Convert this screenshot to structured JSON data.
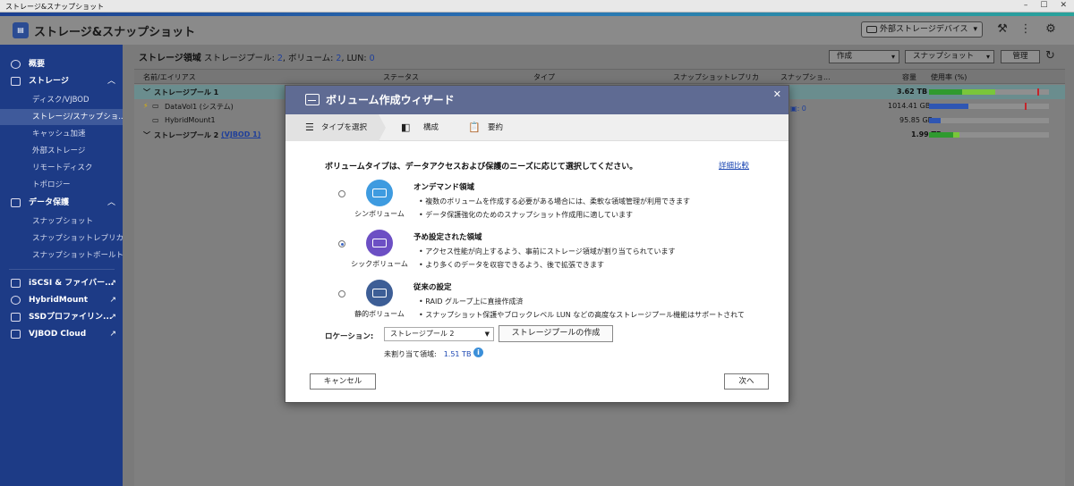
{
  "window": {
    "title": "ストレージ&スナップショット",
    "controls": [
      "–",
      "☐",
      "✕"
    ]
  },
  "app": {
    "title": "ストレージ&スナップショット",
    "external_device_label": "外部ストレージデバイス"
  },
  "sidebar": {
    "overview": "概要",
    "storage_section": "ストレージ",
    "storage_items": [
      "ディスク/VJBOD",
      "ストレージ/スナップショ...",
      "キャッシュ加速",
      "外部ストレージ",
      "リモートディスク",
      "トポロジー"
    ],
    "protection_section": "データ保護",
    "protection_items": [
      "スナップショット",
      "スナップショットレプリカ",
      "スナップショットボールト"
    ],
    "extras": [
      "iSCSI & ファイバー...",
      "HybridMount",
      "SSDプロファイリン...",
      "VJBOD Cloud"
    ]
  },
  "main": {
    "breadcrumb": {
      "title": "ストレージ領域",
      "pools_label": "ストレージプール: ",
      "pools": "2",
      "volumes_label": ", ボリューム: ",
      "volumes": "2",
      "lun_label": ", LUN: ",
      "lun": "0"
    },
    "toolbar": {
      "create": "作成",
      "snapshot": "スナップショット",
      "manage": "管理"
    },
    "columns": [
      "名前/エイリアス",
      "ステータス",
      "タイプ",
      "スナップショットレプリカ",
      "スナップショ...",
      "容量",
      "使用率 (%)"
    ],
    "rows": [
      {
        "name": "ストレージプール 1",
        "capacity": "3.62 TB",
        "usage": 0.55,
        "threshold": 0.9
      },
      {
        "name": "DataVol1 (システム)",
        "capacity": "1014.41 GB",
        "usage": 0.33,
        "threshold": 0.8
      },
      {
        "name": "HybridMount1",
        "capacity": "95.85 GB",
        "usage": 0.1,
        "threshold": 0
      },
      {
        "name": "ストレージプール 2",
        "link": "(VJBOD 1)",
        "capacity": "1.99 TB",
        "usage": 0.25,
        "threshold": 0
      }
    ],
    "snapshot_indicator": ": 0"
  },
  "dialog": {
    "title": "ボリューム作成ウィザード",
    "steps": [
      "タイプを選択",
      "構成",
      "要約"
    ],
    "prompt": "ボリュームタイプは、データアクセスおよび保護のニーズに応じて選択してください。",
    "detail_link": "詳細比較",
    "options": [
      {
        "caption": "シンボリューム",
        "title": "オンデマンド領域",
        "lines": [
          "• 複数のボリュームを作成する必要がある場合には、柔軟な領域管理が利用できます",
          "• データ保護強化のためのスナップショット作成用に適しています"
        ],
        "selected": false,
        "color": "#3e9be0"
      },
      {
        "caption": "シックボリューム",
        "title": "予め設定された領域",
        "lines": [
          "• アクセス性能が向上するよう、事前にストレージ領域が割り当てられています",
          "• より多くのデータを収容できるよう、後で拡張できます"
        ],
        "selected": true,
        "color": "#6c4fc4"
      },
      {
        "caption": "静的ボリューム",
        "title": "従来の設定",
        "lines": [
          "• RAID グループ上に直接作成済",
          "• スナップショット保護やブロックレベル LUN などの高度なストレージプール機能はサポートされて"
        ],
        "selected": false,
        "color": "#3d5e96"
      }
    ],
    "location_label": "ロケーション:",
    "location_value": "ストレージプール 2",
    "create_pool_button": "ストレージプールの作成",
    "unallocated_label": "未割り当て領域:",
    "unallocated_value": "1.51 TB",
    "cancel_button": "キャンセル",
    "next_button": "次へ"
  },
  "colors": {
    "sidebar": "#1d3b86",
    "dialog_header": "#5f6b93",
    "accent": "#1d48b3",
    "usage_green": "#2f9a2f",
    "usage_blue": "#2f56b3"
  }
}
